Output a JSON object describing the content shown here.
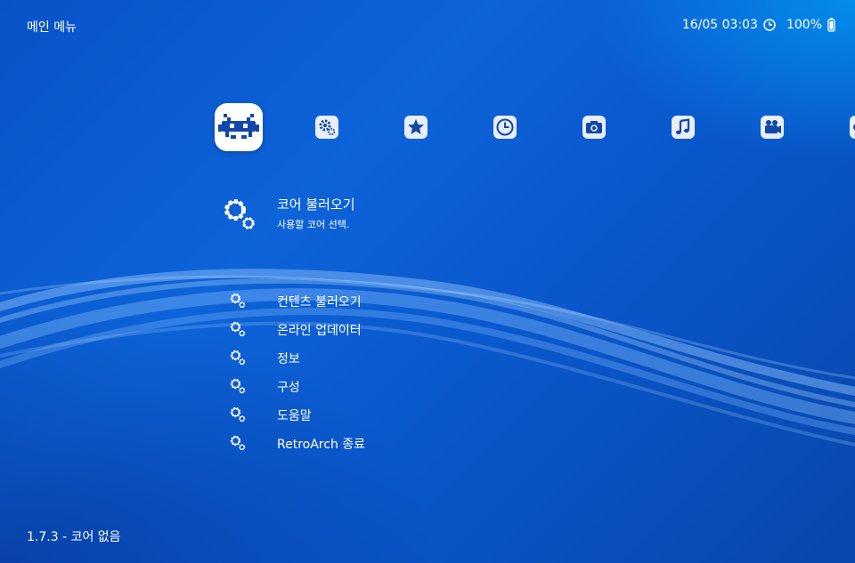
{
  "header": {
    "title": "메인 메뉴",
    "datetime": "16/05 03:03",
    "battery": "100%"
  },
  "tabs": [
    {
      "name": "main-menu",
      "icon": "retroarch-logo-icon",
      "active": true
    },
    {
      "name": "settings",
      "icon": "settings-icon",
      "active": false
    },
    {
      "name": "favorites",
      "icon": "star-icon",
      "active": false
    },
    {
      "name": "history",
      "icon": "clock-icon",
      "active": false
    },
    {
      "name": "images",
      "icon": "camera-icon",
      "active": false
    },
    {
      "name": "music",
      "icon": "music-note-icon",
      "active": false
    },
    {
      "name": "video",
      "icon": "video-camera-icon",
      "active": false
    },
    {
      "name": "netplay",
      "icon": "partial-icon",
      "active": false
    }
  ],
  "selected": {
    "label": "코어 불러오기",
    "sublabel": "사용할 코어 선택."
  },
  "menu": {
    "items": [
      {
        "label": "컨텐츠 불러오기"
      },
      {
        "label": "온라인 업데이터"
      },
      {
        "label": "정보"
      },
      {
        "label": "구성"
      },
      {
        "label": "도움말"
      },
      {
        "label": "RetroArch 종료"
      }
    ]
  },
  "footer": {
    "version": "1.7.3 - 코어 없음"
  },
  "colors": {
    "background": "#0a57cc",
    "accent": "#1147a8",
    "text": "#ffffff"
  }
}
